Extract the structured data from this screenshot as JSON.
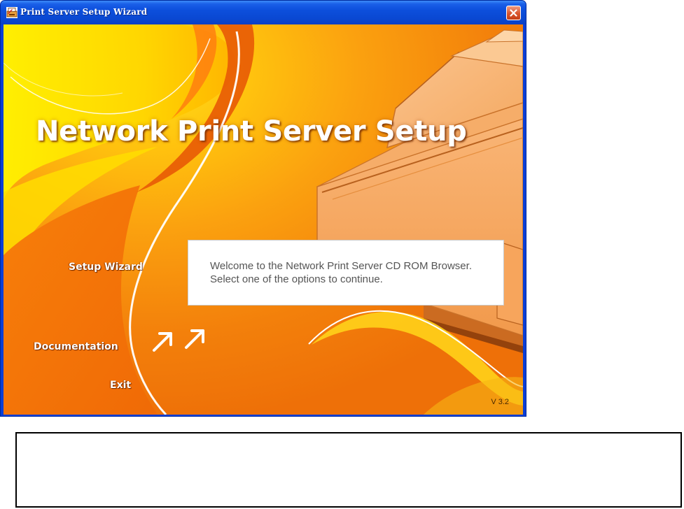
{
  "window": {
    "title": "Print Server Setup Wizard"
  },
  "main": {
    "headline": "Network Print Server Setup",
    "menu": {
      "setup_wizard": "Setup Wizard",
      "documentation": "Documentation",
      "exit": "Exit"
    },
    "welcome_message": "Welcome to the Network Print Server CD ROM Browser. Select one of the options to continue.",
    "version": "V 3.2"
  },
  "icons": {
    "app": "printer-app-icon",
    "close": "close-icon",
    "arrows": "double-arrow-icon"
  },
  "colors": {
    "title_bar": "#0a48d2",
    "close_button": "#d9542c",
    "background_orange": "#f28a0c",
    "background_yellow": "#fff200",
    "text_white": "#ffffff"
  }
}
